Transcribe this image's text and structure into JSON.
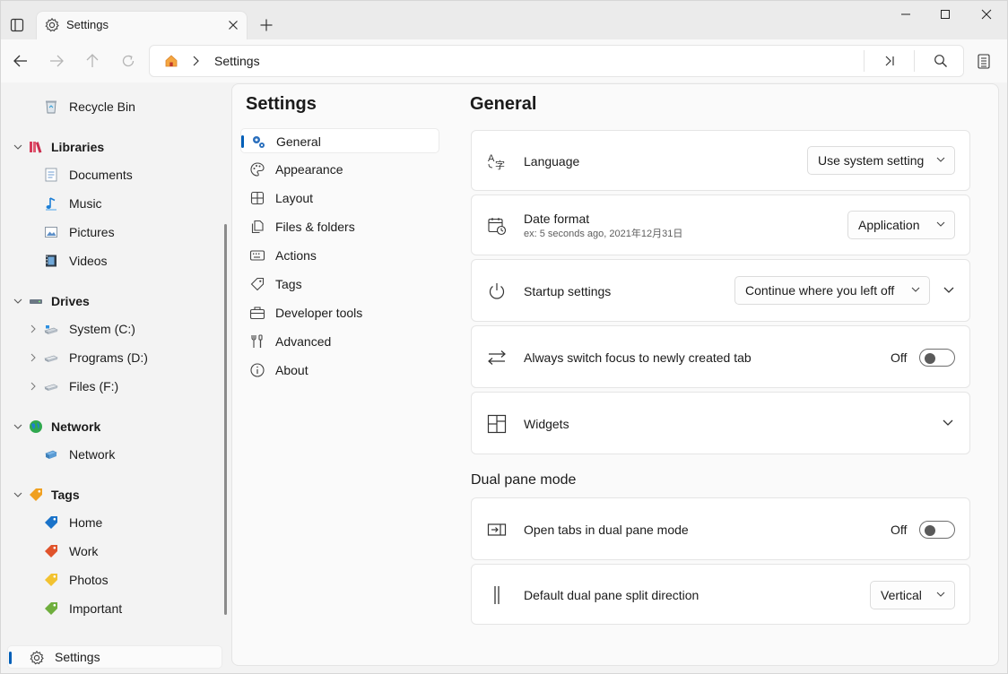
{
  "tab": {
    "title": "Settings"
  },
  "address": {
    "crumb": "Settings"
  },
  "sidebar": {
    "recycle_bin": "Recycle Bin",
    "libraries": {
      "label": "Libraries",
      "items": [
        "Documents",
        "Music",
        "Pictures",
        "Videos"
      ]
    },
    "drives": {
      "label": "Drives",
      "items": [
        "System (C:)",
        "Programs (D:)",
        "Files (F:)"
      ]
    },
    "network": {
      "label": "Network",
      "items": [
        "Network"
      ]
    },
    "tags": {
      "label": "Tags",
      "items": [
        "Home",
        "Work",
        "Photos",
        "Important"
      ]
    },
    "settings": "Settings"
  },
  "settings_nav": {
    "title": "Settings",
    "items": [
      "General",
      "Appearance",
      "Layout",
      "Files & folders",
      "Actions",
      "Tags",
      "Developer tools",
      "Advanced",
      "About"
    ]
  },
  "general": {
    "title": "General",
    "language": {
      "label": "Language",
      "value": "Use system setting"
    },
    "date_format": {
      "label": "Date format",
      "example": "ex: 5 seconds ago, 2021年12月31日",
      "value": "Application"
    },
    "startup": {
      "label": "Startup settings",
      "value": "Continue where you left off"
    },
    "switch_focus": {
      "label": "Always switch focus to newly created tab",
      "state": "Off"
    },
    "widgets": {
      "label": "Widgets"
    },
    "dual_pane_header": "Dual pane mode",
    "open_dual": {
      "label": "Open tabs in dual pane mode",
      "state": "Off"
    },
    "split_direction": {
      "label": "Default dual pane split direction",
      "value": "Vertical"
    }
  },
  "colors": {
    "accent": "#005fb8",
    "tag_home": "#1a73c9",
    "tag_work": "#e0532b",
    "tag_photos": "#f2c230",
    "tag_important": "#6fae3d"
  }
}
